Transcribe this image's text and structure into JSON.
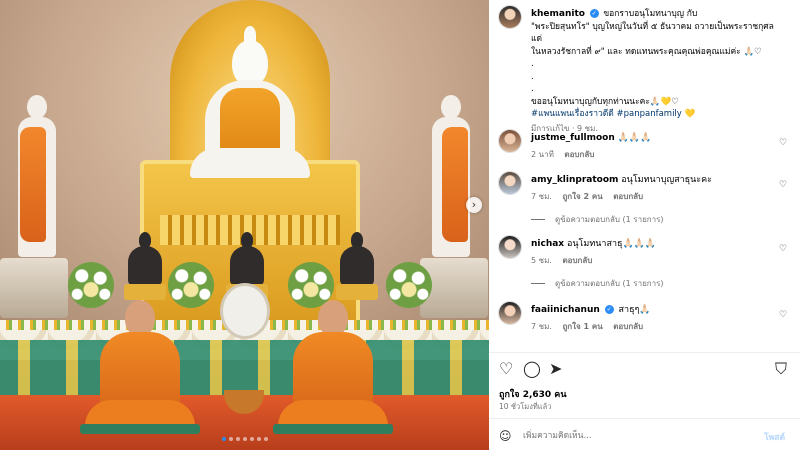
{
  "post": {
    "username": "khemanito",
    "caption_lines": [
      "ขอกราบอนุโมทนาบุญ กับ",
      "\"พระปิยสุนทโร\" บุญใหญ่ในวันที่ ๕ ธันวาคม ถวายเป็นพระราชกุศลแด่",
      "ในหลวงรัชกาลที่ ๙\" และ ทดแทนพระคุณคุณพ่อคุณแม่ค่ะ 🙏🏻♡",
      ".",
      ".",
      ".",
      "ขออนุโมทนาบุญกับทุกท่านนะคะ🙏🏻💛♡"
    ],
    "hashtags": "#แพนแพนเรื่องราวดีดี #panpanfamily 💛",
    "edited_label": "มีการแก้ไข · 9 ชม."
  },
  "comments": [
    {
      "username": "justme_fullmoon",
      "text": "🙏🏻🙏🏻🙏🏻",
      "time": "2 นาที",
      "likes": "",
      "reply": "ตอบกลับ",
      "view_replies": "",
      "verified": false
    },
    {
      "username": "amy_klinpratoom",
      "text": "อนุโมทนาบุญสาธุนะคะ",
      "time": "7 ชม.",
      "likes": "ถูกใจ 2 คน",
      "reply": "ตอบกลับ",
      "view_replies": "ดูข้อความตอบกลับ (1 รายการ)",
      "verified": false
    },
    {
      "username": "nichax",
      "text": "อนุโมทนาสาธุ🙏🏻🙏🏻🙏🏻",
      "time": "5 ชม.",
      "likes": "",
      "reply": "ตอบกลับ",
      "view_replies": "ดูข้อความตอบกลับ (1 รายการ)",
      "verified": false
    },
    {
      "username": "faaiinichanun",
      "text": "สาธุๆ🙏🏻",
      "time": "7 ชม.",
      "likes": "ถูกใจ 1 คน",
      "reply": "ตอบกลับ",
      "view_replies": "",
      "verified": true
    }
  ],
  "stats": {
    "likes": "ถูกใจ 2,630 คน",
    "time_ago": "10 ชั่วโมงที่แล้ว"
  },
  "comment_input": {
    "placeholder": "เพิ่มความคิดเห็น...",
    "post_label": "โพสต์"
  },
  "icons": {
    "heart": "heart-icon",
    "comment": "comment-icon",
    "share": "share-icon",
    "save": "bookmark-icon",
    "emoji": "emoji-icon",
    "next": "chevron-right-icon"
  },
  "colors": {
    "link": "#00376b",
    "verified": "#2a8cf4",
    "muted": "#737373"
  }
}
